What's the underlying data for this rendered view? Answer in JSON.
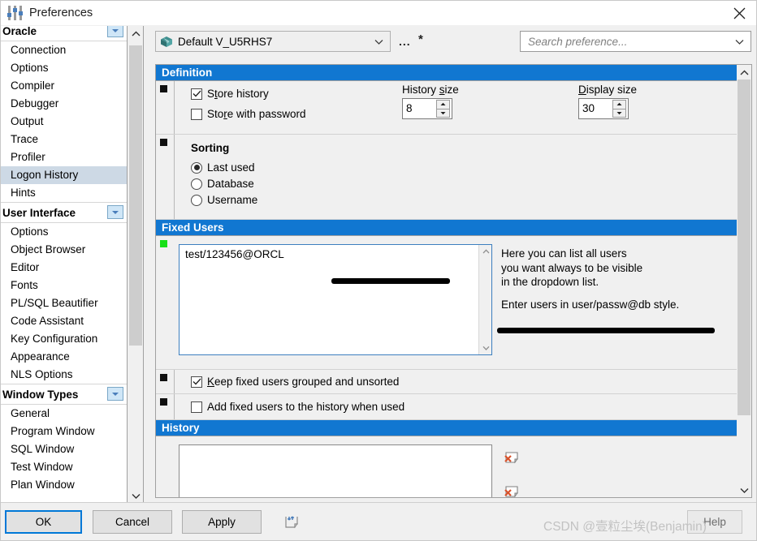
{
  "window": {
    "title": "Preferences",
    "icon": "sliders-icon",
    "close_label": "close-icon"
  },
  "sidebar": {
    "groups": [
      {
        "title": "Oracle",
        "items": [
          {
            "label": "Connection",
            "selected": false
          },
          {
            "label": "Options",
            "selected": false
          },
          {
            "label": "Compiler",
            "selected": false
          },
          {
            "label": "Debugger",
            "selected": false
          },
          {
            "label": "Output",
            "selected": false
          },
          {
            "label": "Trace",
            "selected": false
          },
          {
            "label": "Profiler",
            "selected": false
          },
          {
            "label": "Logon History",
            "selected": true
          },
          {
            "label": "Hints",
            "selected": false
          }
        ]
      },
      {
        "title": "User Interface",
        "items": [
          {
            "label": "Options",
            "selected": false
          },
          {
            "label": "Object Browser",
            "selected": false
          },
          {
            "label": "Editor",
            "selected": false
          },
          {
            "label": "Fonts",
            "selected": false
          },
          {
            "label": "PL/SQL Beautifier",
            "selected": false
          },
          {
            "label": "Code Assistant",
            "selected": false
          },
          {
            "label": "Key Configuration",
            "selected": false
          },
          {
            "label": "Appearance",
            "selected": false
          },
          {
            "label": "NLS Options",
            "selected": false
          }
        ]
      },
      {
        "title": "Window Types",
        "items": [
          {
            "label": "General",
            "selected": false
          },
          {
            "label": "Program Window",
            "selected": false
          },
          {
            "label": "SQL Window",
            "selected": false
          },
          {
            "label": "Test Window",
            "selected": false
          },
          {
            "label": "Plan Window",
            "selected": false
          }
        ]
      }
    ]
  },
  "toolbar": {
    "profile_value": "Default V_U5RHS7",
    "profile_icon": "package-icon",
    "more_button": "...",
    "modified_marker": "*",
    "search_placeholder": "Search preference..."
  },
  "sections": {
    "definition": {
      "header": "Definition",
      "store_history": {
        "label_pre": "S",
        "label_mn": "t",
        "label_post": "ore history",
        "checked": true
      },
      "store_password": {
        "label_pre": "Sto",
        "label_mn": "r",
        "label_post": "e with password",
        "checked": false
      },
      "history_size": {
        "label_pre": "History ",
        "label_mn": "s",
        "label_post": "ize",
        "value": "8"
      },
      "display_size": {
        "label_pre": "",
        "label_mn": "D",
        "label_post": "isplay size",
        "value": "30"
      },
      "sorting": {
        "title": "Sorting",
        "options": [
          {
            "label": "Last used",
            "selected": true
          },
          {
            "label": "Database",
            "selected": false
          },
          {
            "label": "Username",
            "selected": false
          }
        ]
      }
    },
    "fixed_users": {
      "header": "Fixed Users",
      "textarea_value": "test/123456@ORCL",
      "help_paragraph_1": "Here you can list all users\nyou want always to be visible\nin the dropdown list.",
      "help_line_1a": "Here you can list all users",
      "help_line_1b": "you want always to be visible",
      "help_line_1c": "in the dropdown list.",
      "help_line_2": "Enter users in user/passw@db style.",
      "keep_grouped": {
        "label_pre": "",
        "label_mn": "K",
        "label_post": "eep fixed users grouped and unsorted",
        "checked": true
      },
      "add_to_history": {
        "label_pre": "Add fixed users to the history when used",
        "label_mn": "",
        "label_post": "",
        "checked": false
      }
    },
    "history": {
      "header": "History",
      "textarea_value": "",
      "delete_icon_1": "delete-item-icon",
      "delete_icon_2": "delete-all-icon"
    }
  },
  "buttons": {
    "ok": "OK",
    "cancel": "Cancel",
    "apply": "Apply",
    "help": "Help",
    "import_export_icon": "import-export-icon"
  },
  "watermark": "CSDN @壹粒尘埃(Benjamin)",
  "colors": {
    "section_header": "#1177d1",
    "selection": "#cdd9e5",
    "focus_border": "#0078d7",
    "marker_green": "#17e017"
  }
}
